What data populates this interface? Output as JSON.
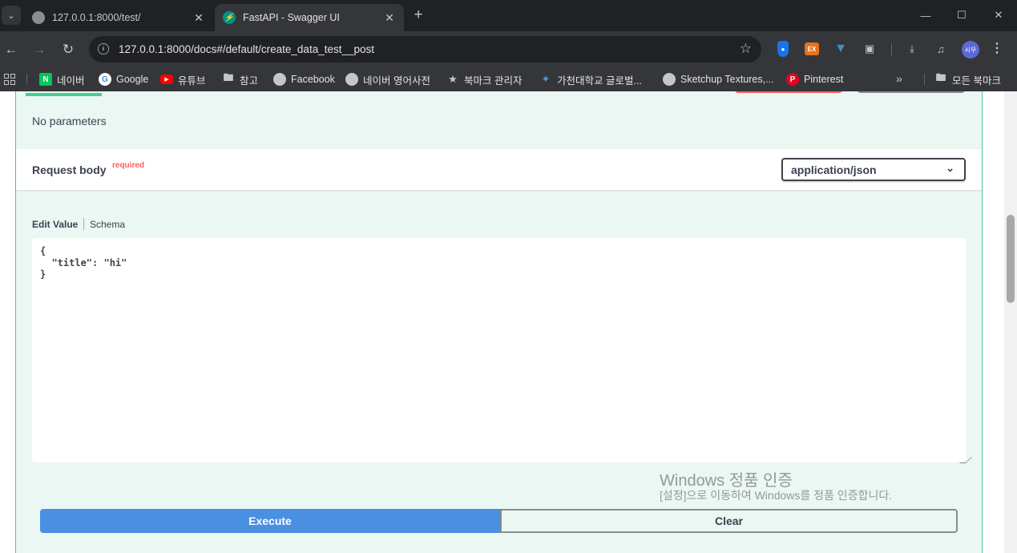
{
  "browser": {
    "tabs": [
      {
        "title": "127.0.0.1:8000/test/",
        "active": false
      },
      {
        "title": "FastAPI - Swagger UI",
        "active": true
      }
    ],
    "url": "127.0.0.1:8000/docs#/default/create_data_test__post",
    "avatar_text": "시우",
    "extension_ex_label": "EX",
    "bookmarks": [
      {
        "label": "네이버",
        "icon": "naver-icon"
      },
      {
        "label": "Google",
        "icon": "google-icon"
      },
      {
        "label": "유튜브",
        "icon": "youtube-icon"
      },
      {
        "label": "참고",
        "icon": "folder-icon"
      },
      {
        "label": "Facebook",
        "icon": "globe-icon"
      },
      {
        "label": "네이버 영어사전",
        "icon": "globe-icon"
      },
      {
        "label": "북마크 관리자",
        "icon": "star-icon"
      },
      {
        "label": "가천대학교 글로벌...",
        "icon": "gachon-icon"
      },
      {
        "label": "Sketchup Textures,...",
        "icon": "globe-icon"
      },
      {
        "label": "Pinterest",
        "icon": "pinterest-icon"
      }
    ],
    "all_bookmarks_label": "모든 북마크"
  },
  "operation": {
    "no_parameters": "No parameters",
    "request_body": {
      "title": "Request body",
      "required_label": "required",
      "content_type": "application/json"
    },
    "editor_tabs": {
      "edit_value": "Edit Value",
      "schema": "Schema"
    },
    "body_value": "{\n  \"title\": \"hi\"\n}",
    "execute_label": "Execute",
    "clear_label": "Clear"
  },
  "watermark": {
    "title": "Windows 정품 인증",
    "subtitle": "[설정]으로 이동하여 Windows를 정품 인증합니다."
  },
  "colors": {
    "post_green": "#49cc90",
    "execute_blue": "#4990e2",
    "required_red": "#ff6060"
  }
}
